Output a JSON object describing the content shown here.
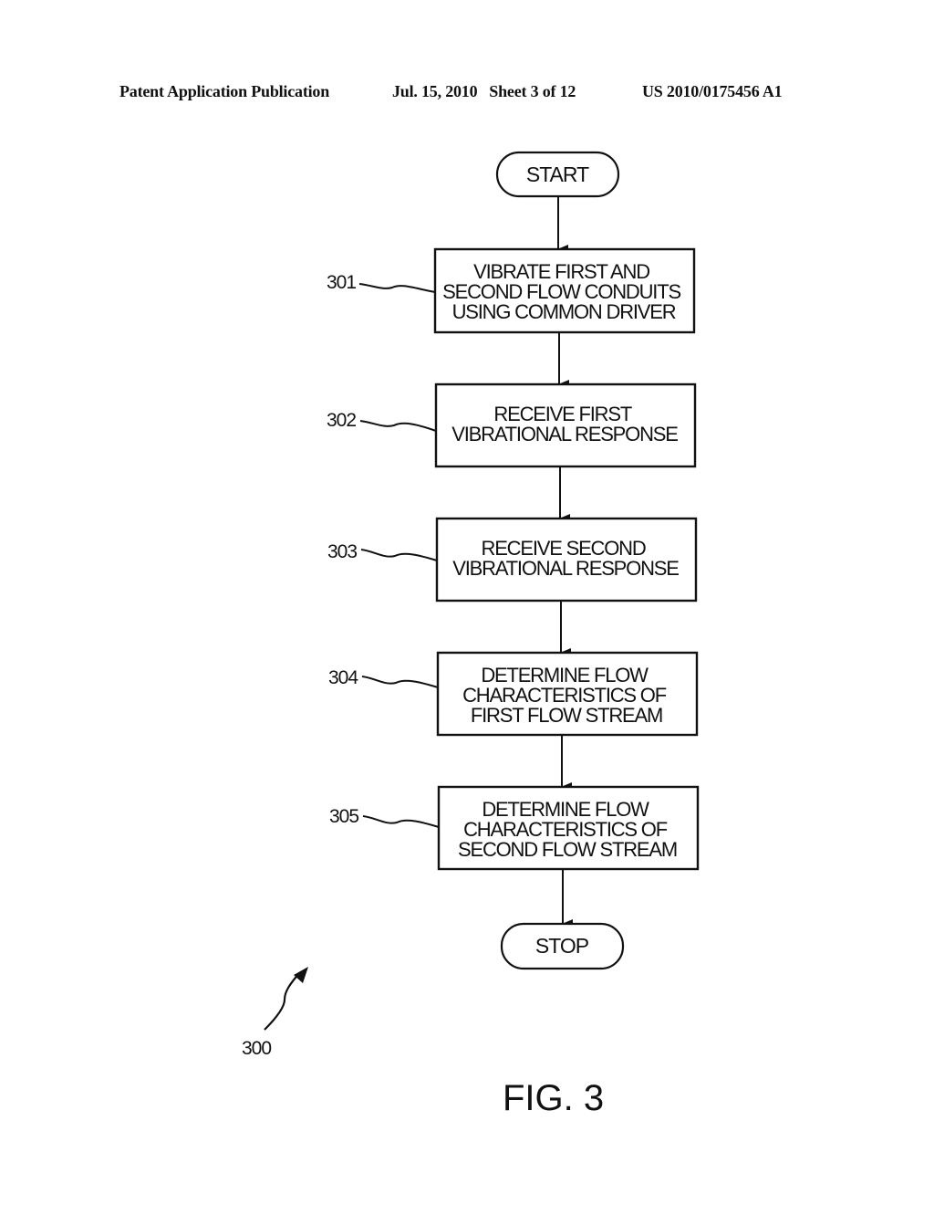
{
  "header": {
    "publication_label": "Patent Application Publication",
    "date_sheet": "Jul. 15, 2010   Sheet 3 of 12",
    "publication_number": "US 2010/0175456 A1"
  },
  "flowchart": {
    "start_label": "START",
    "stop_label": "STOP",
    "steps": [
      {
        "ref": "301",
        "lines": [
          "VIBRATE FIRST AND",
          "SECOND FLOW CONDUITS",
          "USING COMMON DRIVER"
        ]
      },
      {
        "ref": "302",
        "lines": [
          "RECEIVE FIRST",
          "VIBRATIONAL RESPONSE"
        ]
      },
      {
        "ref": "303",
        "lines": [
          "RECEIVE SECOND",
          "VIBRATIONAL RESPONSE"
        ]
      },
      {
        "ref": "304",
        "lines": [
          "DETERMINE FLOW",
          "CHARACTERISTICS OF",
          "FIRST FLOW STREAM"
        ]
      },
      {
        "ref": "305",
        "lines": [
          "DETERMINE FLOW",
          "CHARACTERISTICS OF",
          "SECOND FLOW STREAM"
        ]
      }
    ],
    "figure_ref": "300"
  },
  "figure_label": "FIG. 3"
}
